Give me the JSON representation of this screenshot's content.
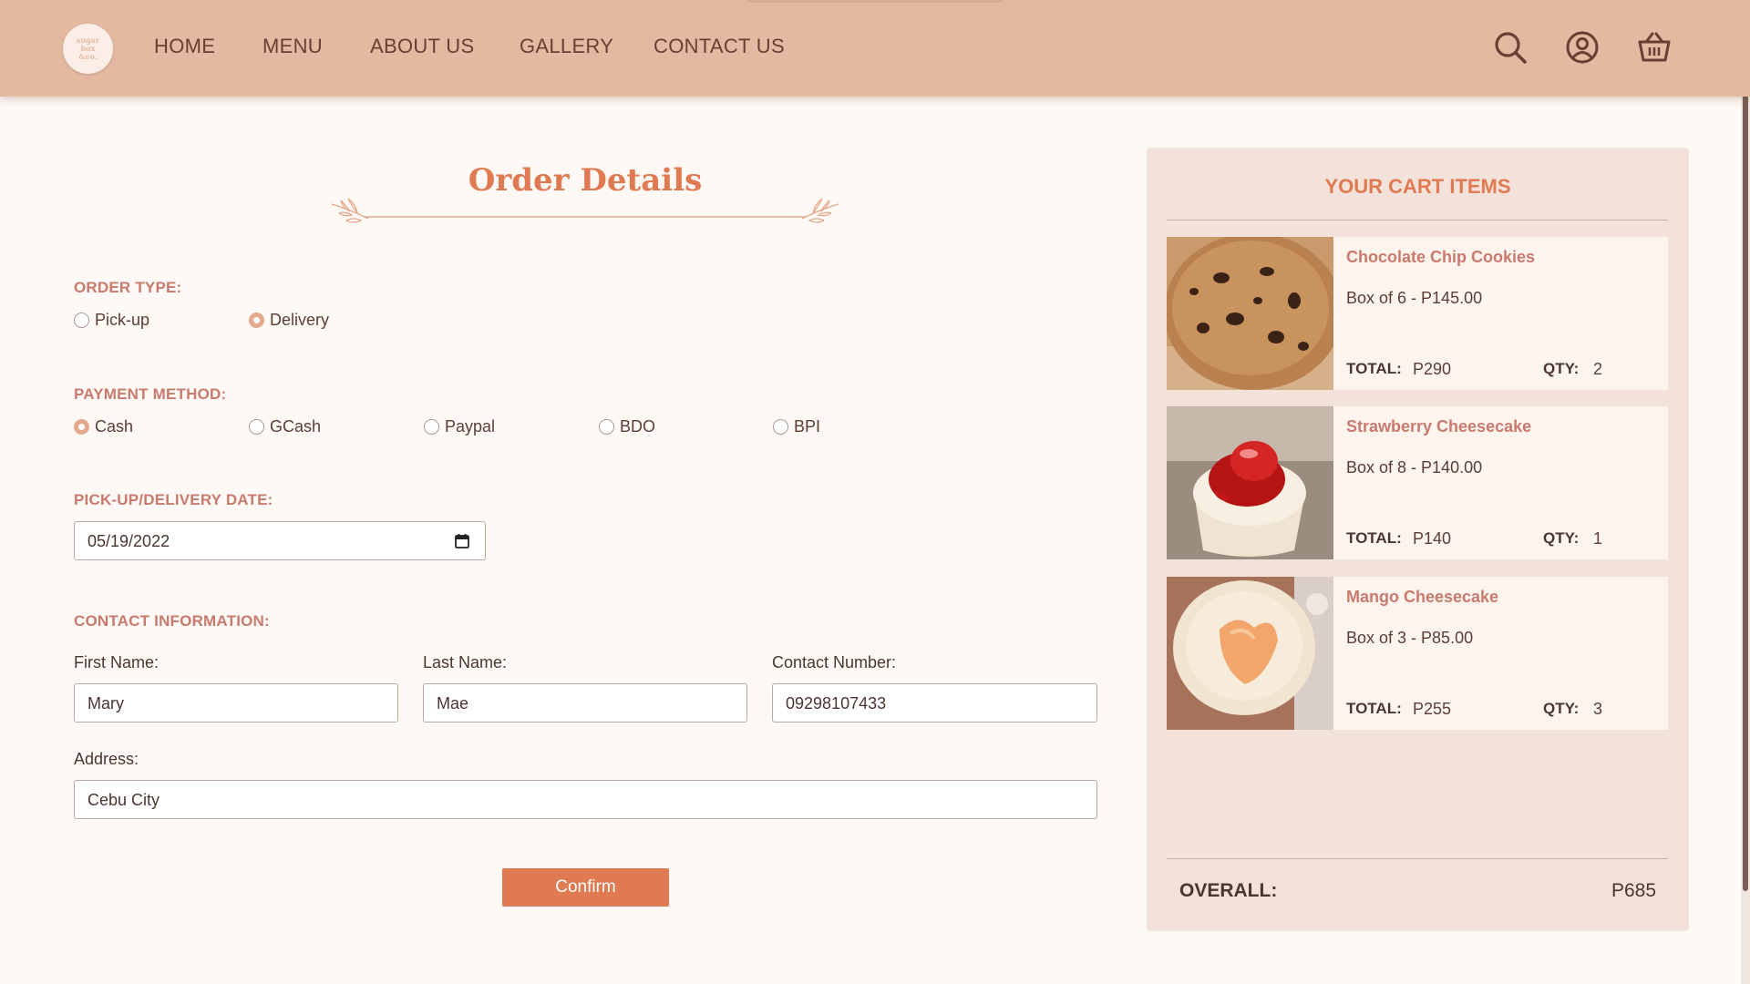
{
  "brand": {
    "logo_lines": [
      "sugar",
      "box",
      "&co."
    ]
  },
  "nav": {
    "items": [
      {
        "label": "HOME"
      },
      {
        "label": "MENU"
      },
      {
        "label": "ABOUT US"
      },
      {
        "label": "GALLERY"
      },
      {
        "label": "CONTACT US"
      }
    ],
    "icons": [
      "search-icon",
      "user-icon",
      "cart-icon"
    ]
  },
  "form": {
    "title": "Order Details",
    "order_type": {
      "label": "ORDER TYPE:",
      "options": [
        {
          "label": "Pick-up",
          "checked": false
        },
        {
          "label": "Delivery",
          "checked": true
        }
      ]
    },
    "payment": {
      "label": "PAYMENT METHOD:",
      "options": [
        {
          "label": "Cash",
          "checked": true
        },
        {
          "label": "GCash",
          "checked": false
        },
        {
          "label": "Paypal",
          "checked": false
        },
        {
          "label": "BDO",
          "checked": false
        },
        {
          "label": "BPI",
          "checked": false
        }
      ]
    },
    "date": {
      "label": "PICK-UP/DELIVERY DATE:",
      "value": "05/19/2022"
    },
    "contact": {
      "label": "CONTACT INFORMATION:",
      "first_name_label": "First Name:",
      "first_name": "Mary",
      "last_name_label": "Last Name:",
      "last_name": "Mae",
      "contact_number_label": "Contact Number:",
      "contact_number": "09298107433",
      "address_label": "Address:",
      "address": "Cebu City"
    },
    "confirm_label": "Confirm"
  },
  "cart": {
    "title": "YOUR CART ITEMS",
    "total_label": "TOTAL:",
    "qty_label": "QTY:",
    "items": [
      {
        "name": "Chocolate Chip Cookies",
        "desc": "Box of 6 - P145.00",
        "total": "P290",
        "qty": "2"
      },
      {
        "name": "Strawberry Cheesecake",
        "desc": "Box of 8 - P140.00",
        "total": "P140",
        "qty": "1"
      },
      {
        "name": "Mango Cheesecake",
        "desc": "Box of 3 - P85.00",
        "total": "P255",
        "qty": "3"
      }
    ],
    "overall_label": "OVERALL:",
    "overall_value": "P685"
  },
  "colors": {
    "header_bg": "#e4b9a1",
    "accent": "#e07a52",
    "label_rose": "#c97a6e",
    "page_bg": "#fef9f4",
    "cart_panel_bg": "#f3e2d9"
  }
}
